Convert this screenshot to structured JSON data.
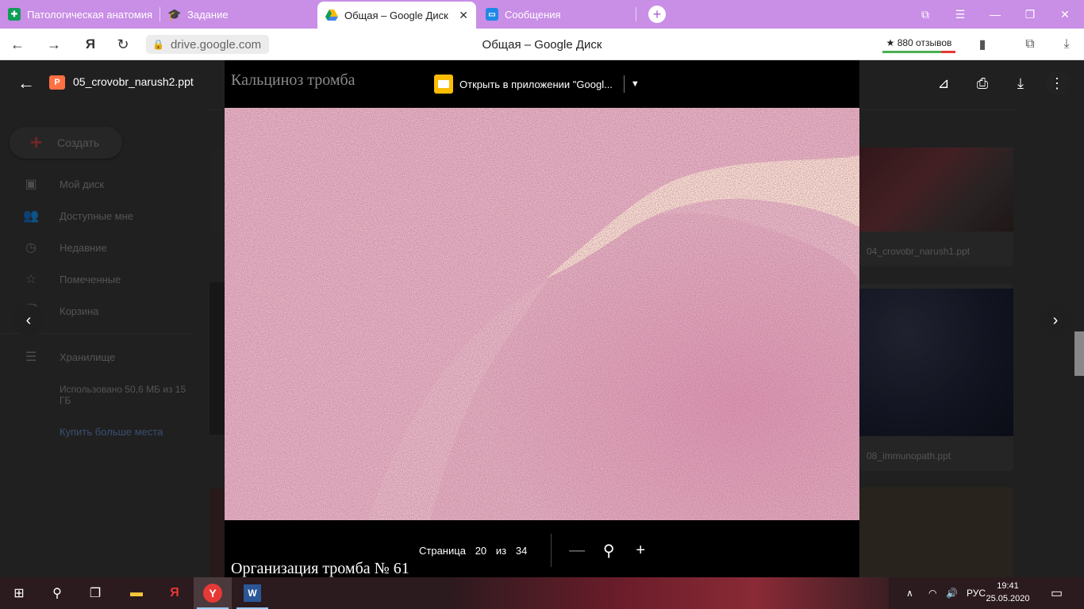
{
  "browser": {
    "tabs": [
      {
        "label": "Патологическая анатомия",
        "icon": "sheets-icon",
        "color": "#0f9d58"
      },
      {
        "label": "Задание",
        "icon": "moodle-icon",
        "color": "#f57c00"
      },
      {
        "label": "Общая – Google Диск",
        "icon": "drive-icon",
        "color": "#fbbc04"
      },
      {
        "label": "Сообщения",
        "icon": "messages-icon",
        "color": "#1e88e5"
      }
    ],
    "url": "drive.google.com",
    "page_title": "Общая – Google Диск",
    "reviews": "★ 880 отзывов"
  },
  "drive": {
    "create_label": "Создать",
    "nav": [
      "Мой диск",
      "Доступные мне",
      "Недавние",
      "Помеченные",
      "Корзина"
    ],
    "storage_label": "Хранилище",
    "storage_used": "Использовано 50,6 МБ из 15 ГБ",
    "buy_more": "Купить больше места",
    "files": [
      "04_crovobr_narush1.ppt",
      "08_immunopath.ppt"
    ]
  },
  "viewer": {
    "file_name": "05_crovobr_narush2.ppt",
    "open_with": "Открыть в приложении \"Googl...",
    "slide_title": "Кальциноз тромба",
    "slide_next_caption": "Организация тромба № 61",
    "page_label": "Страница",
    "page_current": "20",
    "page_of": "из",
    "page_total": "34"
  },
  "taskbar": {
    "lang": "РУС",
    "time": "19:41",
    "date": "25.05.2020"
  }
}
